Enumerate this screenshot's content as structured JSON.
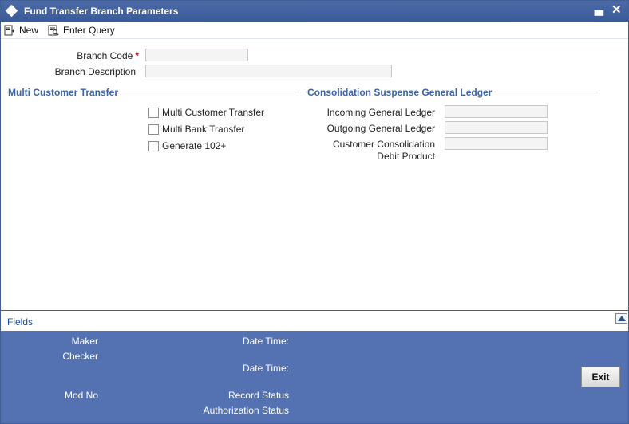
{
  "window": {
    "title": "Fund Transfer Branch Parameters"
  },
  "toolbar": {
    "new_label": "New",
    "enter_query_label": "Enter Query"
  },
  "branch": {
    "code_label": "Branch Code",
    "required_mark": "*",
    "code_value": "",
    "description_label": "Branch Description",
    "description_value": ""
  },
  "multi_customer": {
    "title": "Multi Customer Transfer",
    "options": [
      {
        "label": "Multi Customer Transfer",
        "checked": false
      },
      {
        "label": "Multi Bank Transfer",
        "checked": false
      },
      {
        "label": "Generate 102+",
        "checked": false
      }
    ]
  },
  "consolidation": {
    "title": "Consolidation Suspense General Ledger",
    "incoming_label": "Incoming General Ledger",
    "incoming_value": "",
    "outgoing_label": "Outgoing General Ledger",
    "outgoing_value": "",
    "customer_line1": "Customer Consolidation",
    "customer_line2": "Debit Product",
    "customer_value": ""
  },
  "fields_bar": {
    "label": "Fields"
  },
  "footer": {
    "maker_label": "Maker",
    "checker_label": "Checker",
    "date_time_label": "Date Time:",
    "date_time2_label": "Date Time:",
    "mod_no_label": "Mod No",
    "record_status_label": "Record Status",
    "authorization_status_label": "Authorization Status",
    "exit_label": "Exit"
  },
  "colors": {
    "titlebar": "#3b5b98",
    "footer": "#5472b1",
    "section_title": "#3c65a8",
    "required": "#d11111"
  },
  "icons": {
    "title": "diamond-icon",
    "minimize": "minimize-icon",
    "close": "close-icon",
    "new": "new-document-icon",
    "enter_query": "enter-query-icon",
    "collapse": "chevron-up-icon"
  }
}
